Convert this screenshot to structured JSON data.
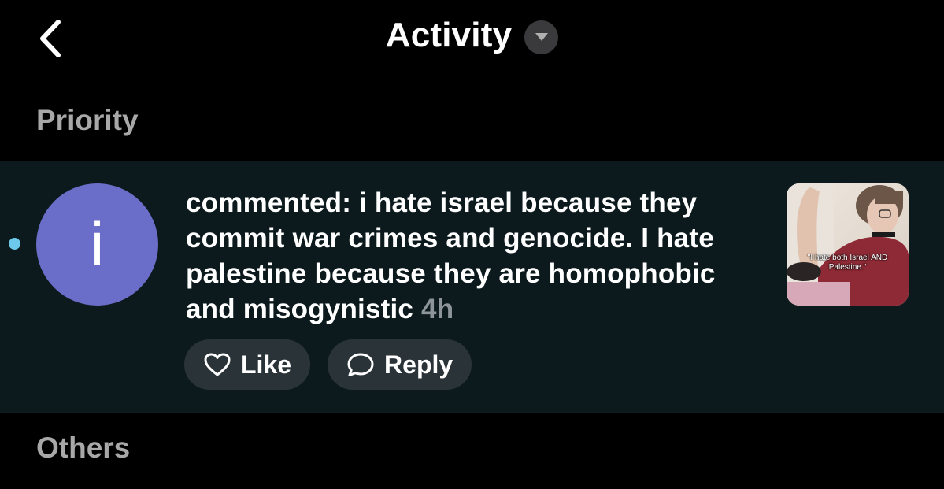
{
  "header": {
    "title": "Activity",
    "back_icon": "chevron-left-icon",
    "dropdown_icon": "caret-down-icon"
  },
  "sections": {
    "priority_label": "Priority",
    "others_label": "Others"
  },
  "notification": {
    "unread": true,
    "avatar_letter": "i",
    "avatar_color": "#6b6ec8",
    "text": " commented: i hate israel because they commit war crimes and genocide. I hate palestine because they are homophobic and misogynistic",
    "time": "4h",
    "thumbnail_caption": "\"I hate both Israel AND Palestine.\"",
    "actions": {
      "like_label": "Like",
      "like_icon": "heart-icon",
      "reply_label": "Reply",
      "reply_icon": "speech-bubble-icon"
    }
  },
  "colors": {
    "background": "#000000",
    "row_background": "#0c1a1e",
    "unread_dot": "#6cc9ec",
    "pill_background": "#2a3438",
    "section_label": "#a8a8a8",
    "timestamp": "#8e959a"
  }
}
